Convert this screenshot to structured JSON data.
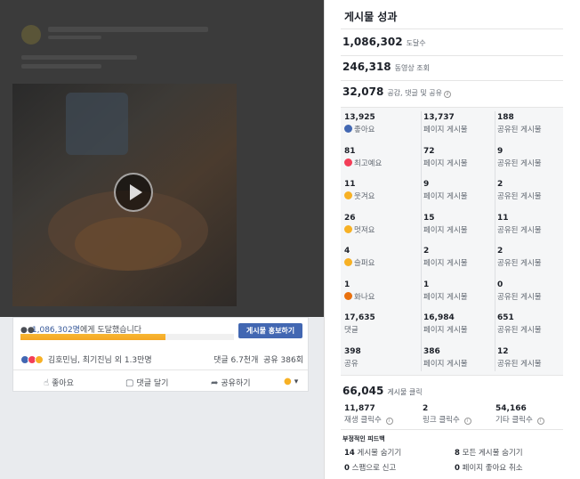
{
  "post": {
    "reach_count": "1,086,302명",
    "reach_suffix": "에게 도달했습니다",
    "reach_progress_fraction": 0.68,
    "boost_label": "게시물 홍보하기",
    "reactors_text": "김호민님, 최기진님 외 1.3만명",
    "comments_text": "댓글 6.7천개",
    "shares_text": "공유 386회",
    "like_label": "좋아요",
    "comment_label": "댓글 달기",
    "share_label": "공유하기"
  },
  "insights": {
    "title": "게시물 성과",
    "reach": {
      "value": "1,086,302",
      "label": "도달수"
    },
    "video_views": {
      "value": "246,318",
      "label": "동영상 조회"
    },
    "engagement": {
      "value": "32,078",
      "label": "공감, 댓글 및 공유"
    },
    "rows": [
      {
        "total": "13,925",
        "label": "좋아요",
        "icon": "like-icon",
        "color": "#4267b2",
        "page": "13,737",
        "shared": "188"
      },
      {
        "total": "81",
        "label": "최고예요",
        "icon": "love-icon",
        "color": "#f33e58",
        "page": "72",
        "shared": "9"
      },
      {
        "total": "11",
        "label": "웃겨요",
        "icon": "haha-icon",
        "color": "#f7b125",
        "page": "9",
        "shared": "2"
      },
      {
        "total": "26",
        "label": "멋져요",
        "icon": "wow-icon",
        "color": "#f7b125",
        "page": "15",
        "shared": "11"
      },
      {
        "total": "4",
        "label": "슬퍼요",
        "icon": "sad-icon",
        "color": "#f7b125",
        "page": "2",
        "shared": "2"
      },
      {
        "total": "1",
        "label": "화나요",
        "icon": "angry-icon",
        "color": "#e9710f",
        "page": "1",
        "shared": "0"
      },
      {
        "total": "17,635",
        "label": "댓글",
        "icon": "",
        "color": "",
        "page": "16,984",
        "shared": "651"
      },
      {
        "total": "398",
        "label": "공유",
        "icon": "",
        "color": "",
        "page": "386",
        "shared": "12"
      }
    ],
    "page_post_label": "페이지 게시물",
    "shared_post_label": "공유된 게시물",
    "clicks": {
      "value": "66,045",
      "label": "게시물 클릭"
    },
    "click_breakdown": [
      {
        "value": "11,877",
        "label": "재생 클릭수"
      },
      {
        "value": "2",
        "label": "링크 클릭수"
      },
      {
        "value": "54,166",
        "label": "기타 클릭수"
      }
    ],
    "negative_title": "부정적인 피드백",
    "negative": [
      {
        "value": "14",
        "label": "게시물 숨기기"
      },
      {
        "value": "8",
        "label": "모든 게시물 숨기기"
      },
      {
        "value": "0",
        "label": "스팸으로 신고"
      },
      {
        "value": "0",
        "label": "페이지 좋아요 취소"
      }
    ]
  }
}
